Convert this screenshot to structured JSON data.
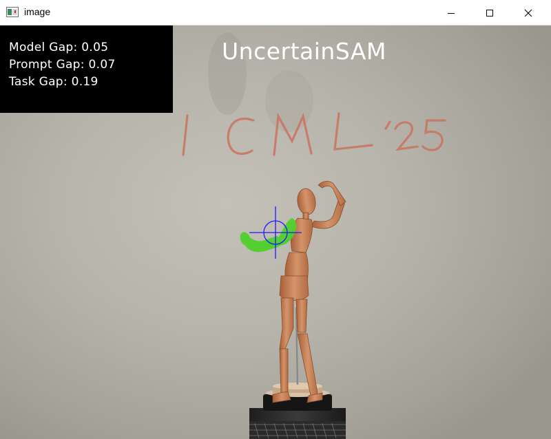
{
  "window": {
    "title": "image",
    "icon": "image-window-icon",
    "controls": [
      "minimize-icon",
      "maximize-icon",
      "close-icon"
    ]
  },
  "overlay": {
    "title": "UncertainSAM",
    "metrics": [
      {
        "text": "Model Gap: 0.05"
      },
      {
        "text": "Prompt Gap: 0.07"
      },
      {
        "text": "Task Gap: 0.19"
      }
    ]
  },
  "scene": {
    "whiteboard_text": "ICML'25",
    "colors": {
      "mask": "#4ed12c",
      "prompt_marker": "#1a1aff",
      "panel": "#000000",
      "overlay_text": "#ffffff"
    }
  }
}
